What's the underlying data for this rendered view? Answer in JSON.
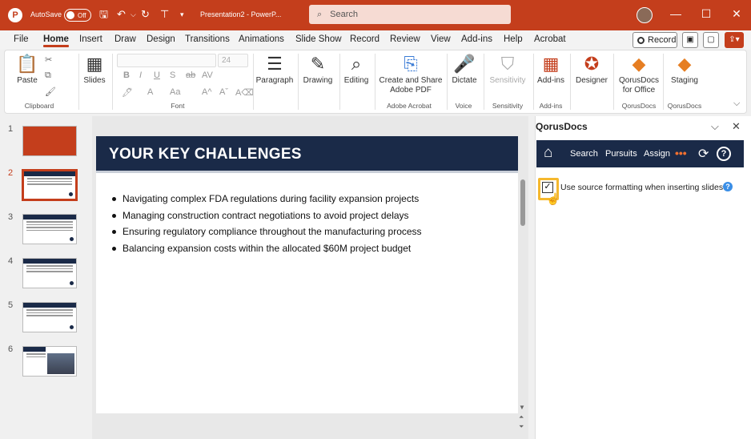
{
  "titlebar": {
    "autosave_label": "AutoSave",
    "autosave_state": "Off",
    "doc_title": "Presentation2 - PowerP...",
    "search_placeholder": "Search"
  },
  "menu": {
    "items": [
      "File",
      "Home",
      "Insert",
      "Draw",
      "Design",
      "Transitions",
      "Animations",
      "Slide Show",
      "Record",
      "Review",
      "View",
      "Add-ins",
      "Help",
      "Acrobat"
    ],
    "active": "Home",
    "record_label": "Record"
  },
  "ribbon": {
    "paste": "Paste",
    "slides": "Slides",
    "paragraph": "Paragraph",
    "drawing": "Drawing",
    "editing": "Editing",
    "create_share_1": "Create and Share",
    "create_share_2": "Adobe PDF",
    "dictate": "Dictate",
    "sensitivity": "Sensitivity",
    "addins": "Add-ins",
    "designer": "Designer",
    "qorus_1": "QorusDocs",
    "qorus_2": "for Office",
    "staging": "Staging",
    "font_size": "24",
    "groups": {
      "clipboard": "Clipboard",
      "font": "Font",
      "adobe": "Adobe Acrobat",
      "voice": "Voice",
      "sensitivity": "Sensitivity",
      "addins": "Add-ins",
      "qorus1": "QorusDocs",
      "qorus2": "QorusDocs"
    }
  },
  "thumbs": [
    "1",
    "2",
    "3",
    "4",
    "5",
    "6"
  ],
  "slide": {
    "title": "YOUR KEY CHALLENGES",
    "bullets": [
      "Navigating complex FDA regulations during facility expansion projects",
      "Managing construction contract negotiations to avoid project delays",
      "Ensuring regulatory compliance throughout the manufacturing process",
      "Balancing expansion costs within the allocated $60M project budget"
    ]
  },
  "pane": {
    "title": "QorusDocs",
    "nav": {
      "search": "Search",
      "pursuits": "Pursuits",
      "assign": "Assign",
      "more": "•••"
    },
    "checkbox_label": "Use source formatting when inserting slides",
    "checkbox_checked": true
  },
  "colors": {
    "accent": "#c43e1c",
    "navy": "#1a2a48",
    "highlight": "#f5b82e"
  }
}
